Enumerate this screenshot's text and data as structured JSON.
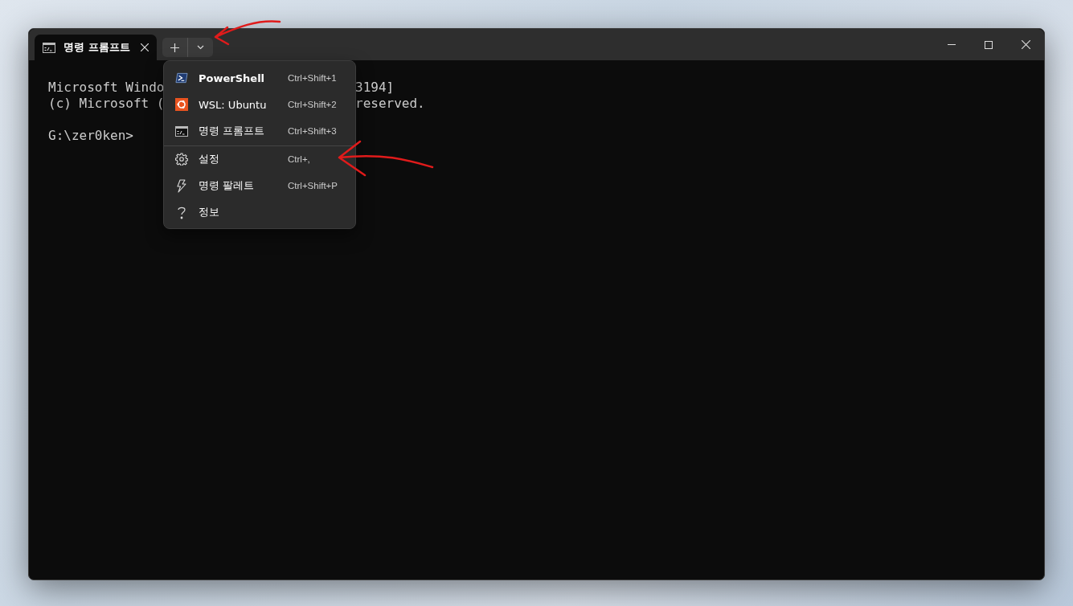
{
  "window": {
    "tabs": [
      {
        "title": "명령 프롬프트",
        "selected": true
      }
    ]
  },
  "terminal": {
    "lines": [
      {
        "left": "Microsoft Windo",
        "right": "3194]"
      },
      {
        "left": "(c) Microsoft (",
        "right": "reserved."
      },
      {
        "left": "G:\\zer0ken>"
      }
    ]
  },
  "dropdown_menu": {
    "items": [
      {
        "label": "PowerShell",
        "shortcut": "Ctrl+Shift+1",
        "bold": true,
        "separator_before": false
      },
      {
        "label": "WSL: Ubuntu",
        "shortcut": "Ctrl+Shift+2",
        "bold": false,
        "separator_before": false
      },
      {
        "label": "명령 프롬프트",
        "shortcut": "Ctrl+Shift+3",
        "bold": false,
        "separator_before": false
      },
      {
        "label": "설정",
        "shortcut": "Ctrl+,",
        "bold": false,
        "separator_before": true
      },
      {
        "label": "명령 팔레트",
        "shortcut": "Ctrl+Shift+P",
        "bold": false,
        "separator_before": false
      },
      {
        "label": "정보",
        "bold": false,
        "separator_before": false
      }
    ]
  }
}
